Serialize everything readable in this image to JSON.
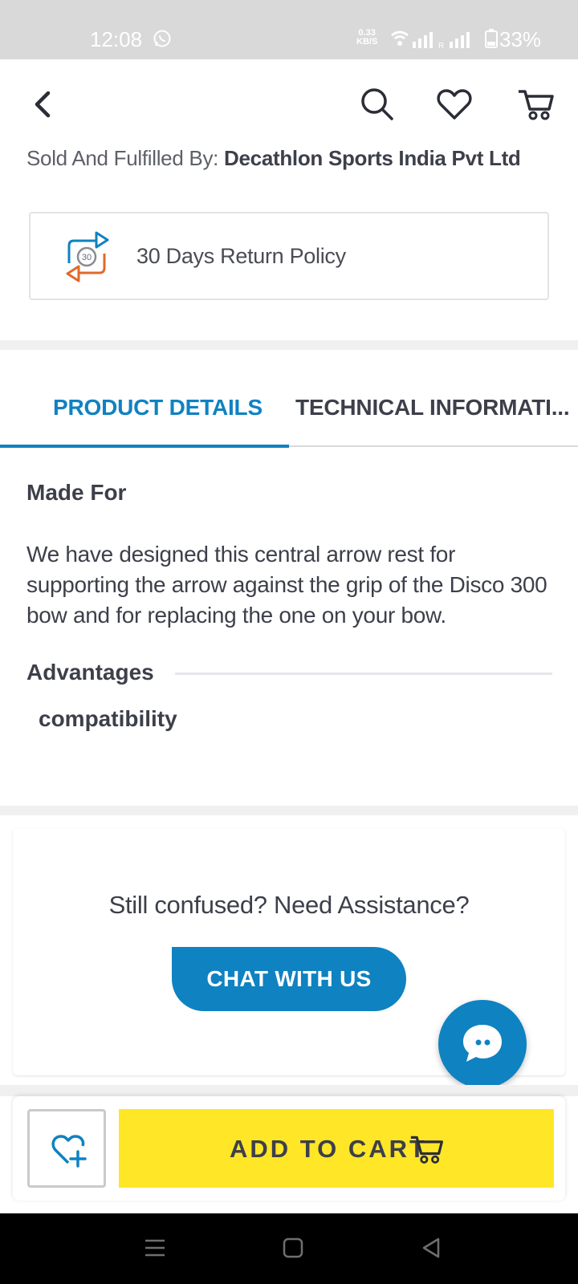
{
  "status_bar": {
    "time": "12:08",
    "speed_value": "0.33",
    "speed_unit": "KB/S",
    "battery": "33%"
  },
  "header": {
    "back_icon": "chevron-left-icon",
    "search_icon": "search-icon",
    "wishlist_icon": "heart-icon",
    "cart_icon": "cart-icon"
  },
  "seller": {
    "label": "Sold And Fulfilled By:",
    "name": "Decathlon Sports India Pvt Ltd"
  },
  "return_policy": {
    "badge": "30",
    "text": "30 Days Return Policy"
  },
  "tabs": [
    {
      "label": "PRODUCT DETAILS",
      "active": true
    },
    {
      "label": "TECHNICAL INFORMATI...",
      "active": false
    }
  ],
  "details": {
    "made_for_title": "Made For",
    "made_for_text": "We have designed this central arrow rest for supporting the arrow against the grip of the Disco 300 bow and for replacing the one on your bow.",
    "advantages_title": "Advantages",
    "advantages": [
      "compatibility"
    ]
  },
  "assistance": {
    "question": "Still confused? Need Assistance?",
    "chat_label": "CHAT WITH US"
  },
  "bottom_bar": {
    "add_to_cart_label": "ADD TO CART"
  },
  "colors": {
    "brand_blue": "#0f82c1",
    "cart_yellow": "#ffe627",
    "text_dark": "#3d3f4a"
  }
}
